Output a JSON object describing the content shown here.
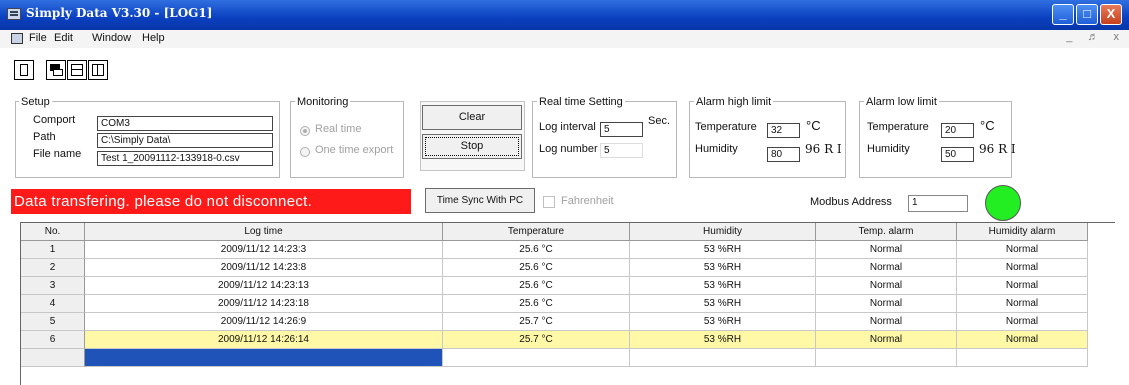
{
  "window": {
    "title": "Simply Data V3.30 - [LOG1]",
    "controls": {
      "minimize": "_",
      "maximize": "□",
      "close": "X"
    },
    "mdi_controls": "_ ♬ x"
  },
  "menu": [
    "File",
    "Edit",
    "Window",
    "Help"
  ],
  "setup": {
    "legend": "Setup",
    "comport_label": "Comport",
    "comport_value": "COM3",
    "path_label": "Path",
    "path_value": "C:\\Simply Data\\",
    "filename_label": "File name",
    "filename_value": "Test 1_20091112-133918-0.csv"
  },
  "monitoring": {
    "legend": "Monitoring",
    "realtime_label": "Real time",
    "export_label": "One time export"
  },
  "buttons": {
    "clear": "Clear",
    "stop": "Stop",
    "timesync": "Time Sync With PC",
    "fahrenheit": "Fahrenheit"
  },
  "realtime": {
    "legend": "Real time Setting",
    "interval_label": "Log interval",
    "interval_value": "5",
    "interval_unit": "Sec.",
    "number_label": "Log number",
    "number_value": "5"
  },
  "alarm_high": {
    "legend": "Alarm high limit",
    "temp_label": "Temperature",
    "temp_value": "32",
    "temp_unit": "°C",
    "hum_label": "Humidity",
    "hum_value": "80",
    "hum_unit": "96 R I"
  },
  "alarm_low": {
    "legend": "Alarm low limit",
    "temp_label": "Temperature",
    "temp_value": "20",
    "temp_unit": "°C",
    "hum_label": "Humidity",
    "hum_value": "50",
    "hum_unit": "96 R I"
  },
  "status": {
    "message": "Data transfering. please do not disconnect.",
    "color": "#ff1a1a",
    "led_color": "#22ee22"
  },
  "modbus": {
    "label": "Modbus Address",
    "value": "1"
  },
  "table": {
    "columns": [
      "No.",
      "Log time",
      "Temperature",
      "Humidity",
      "Temp. alarm",
      "Humidity alarm"
    ],
    "rows": [
      [
        "1",
        "2009/11/12 14:23:3",
        "25.6 °C",
        "53 %RH",
        "Normal",
        "Normal"
      ],
      [
        "2",
        "2009/11/12 14:23:8",
        "25.6 °C",
        "53 %RH",
        "Normal",
        "Normal"
      ],
      [
        "3",
        "2009/11/12 14:23:13",
        "25.6 °C",
        "53 %RH",
        "Normal",
        "Normal"
      ],
      [
        "4",
        "2009/11/12 14:23:18",
        "25.6 °C",
        "53 %RH",
        "Normal",
        "Normal"
      ],
      [
        "5",
        "2009/11/12 14:26:9",
        "25.7 °C",
        "53 %RH",
        "Normal",
        "Normal"
      ],
      [
        "6",
        "2009/11/12 14:26:14",
        "25.7 °C",
        "53 %RH",
        "Normal",
        "Normal"
      ]
    ],
    "selected_row": 6
  }
}
